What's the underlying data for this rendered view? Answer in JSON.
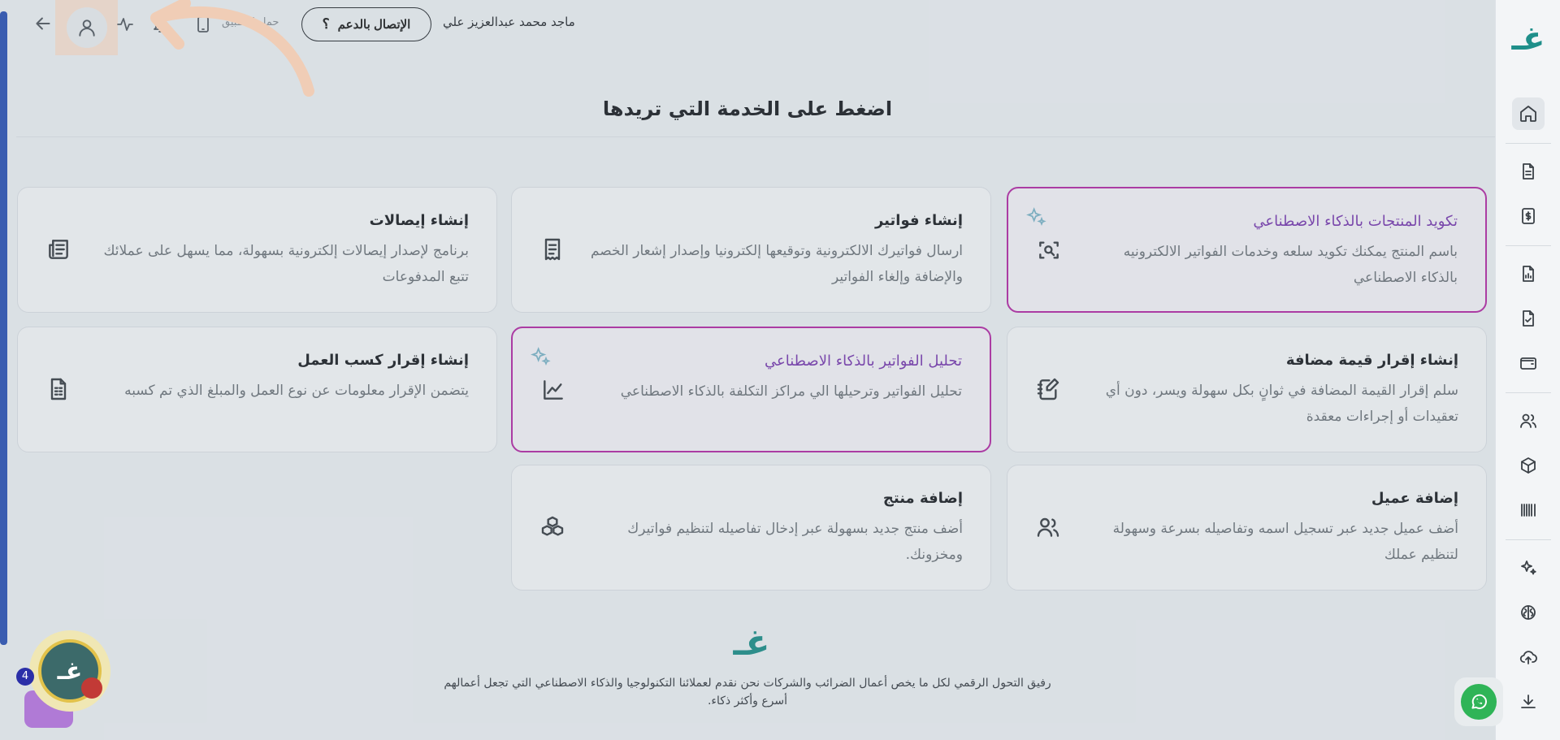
{
  "topbar": {
    "download_label": "حمل التطبيق",
    "support_label": "الإتصال بالدعم",
    "user_name": "ماجد محمد عبدالعزيز علي"
  },
  "main": {
    "title": "اضغط على الخدمة التي تريدها",
    "cards": [
      {
        "title": "تكويد المنتجات بالذكاء الاصطناعي",
        "desc": "باسم المنتج يمكنك تكويد سلعه وخدمات الفواتير الالكترونيه بالذكاء الاصطناعي",
        "icon": "scan-search-icon",
        "ai": true
      },
      {
        "title": "إنشاء فواتير",
        "desc": "ارسال فواتيرك الالكترونية وتوقيعها إلكترونيا وإصدار إشعار الخصم والإضافة وإلغاء الفواتير",
        "icon": "receipt-icon",
        "ai": false
      },
      {
        "title": "إنشاء إيصالات",
        "desc": "برنامج لإصدار إيصالات إلكترونية بسهولة، مما يسهل على عملائك تتبع المدفوعات",
        "icon": "newspaper-icon",
        "ai": false
      },
      {
        "title": "إنشاء إقرار قيمة مضافة",
        "desc": "سلم إقرار القيمة المضافة في ثوانٍ بكل سهولة ويسر، دون أي تعقيدات أو إجراءات معقدة",
        "icon": "notebook-pen-icon",
        "ai": false
      },
      {
        "title": "تحليل الفواتير بالذكاء الاصطناعي",
        "desc": "تحليل الفواتير وترحيلها الي مراكز التكلفة بالذكاء الاصطناعي",
        "icon": "chart-line-icon",
        "ai": true
      },
      {
        "title": "إنشاء إقرار كسب العمل",
        "desc": "يتضمن الإقرار معلومات عن نوع العمل والمبلغ الذي تم كسبه",
        "icon": "file-spreadsheet-icon",
        "ai": false
      },
      {
        "title": "إضافة عميل",
        "desc": "أضف عميل جديد عبر تسجيل اسمه وتفاصيله بسرعة وسهولة لتنظيم عملك",
        "icon": "users-icon",
        "ai": false
      },
      {
        "title": "إضافة منتج",
        "desc": "أضف منتج جديد بسهولة عبر إدخال تفاصيله لتنظيم فواتيرك ومخزونك.",
        "icon": "boxes-icon",
        "ai": false
      }
    ]
  },
  "footer": {
    "text": "رفيق التحول الرقمي لكل ما يخص أعمال الضرائب والشركات نحن نقدم لعملائنا التكنولوجيا والذكاء الاصطناعي التي تجعل أعمالهم أسرع وأكثر ذكاء."
  },
  "chat_widget": {
    "count": "4"
  },
  "colors": {
    "accent_ai": "#b62ea6",
    "brand": "#1f8f8a",
    "whatsapp": "#2fb457"
  }
}
